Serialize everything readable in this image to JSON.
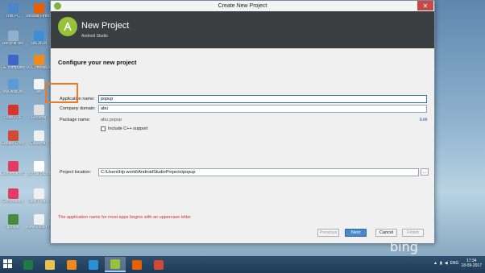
{
  "window": {
    "title": "Create New Project",
    "close_glyph": "✕",
    "minimize_glyph": "–",
    "maximize_glyph": "□"
  },
  "banner": {
    "title": "New Project",
    "subtitle": "Android Studio"
  },
  "form": {
    "heading": "Configure your new project",
    "app_name_label": "Application name:",
    "app_name_value": "popup",
    "company_domain_label": "Company domain:",
    "company_domain_value": "abu",
    "package_name_label": "Package name:",
    "package_name_value": "abu.popup",
    "edit_link": "Edit",
    "cpp_support_label": "Include C++ support",
    "project_location_label": "Project location:",
    "project_location_value": "C:\\Users\\Hp world\\AndroidStudioProjects\\popup",
    "browse_label": "...",
    "warning": "The application name for most apps begins with an uppercase letter"
  },
  "buttons": {
    "previous": "Previous",
    "next": "Next",
    "cancel": "Cancel",
    "finish": "Finish"
  },
  "desktop_icons": [
    {
      "label": "This PC",
      "color": "#4a86c8"
    },
    {
      "label": "Mozilla Firefox",
      "color": "#e66000"
    },
    {
      "label": "Recycle Bin",
      "color": "#8fb0cf"
    },
    {
      "label": "SNCBOB",
      "color": "#3d8fd8"
    },
    {
      "label": "DE computer",
      "color": "#3d66c8"
    },
    {
      "label": "VLC media player",
      "color": "#f08a1c"
    },
    {
      "label": "MyDeskUtil",
      "color": "#5a9bd5"
    },
    {
      "label": "ab",
      "color": "#f5f5f5"
    },
    {
      "label": "Foxit PDF",
      "color": "#d7342b"
    },
    {
      "label": "Resume",
      "color": "#e0e0e0"
    },
    {
      "label": "Google Chrome",
      "color": "#d04a34"
    },
    {
      "label": "Classmay",
      "color": "#f0f0f0"
    },
    {
      "label": "Genymotion Shell",
      "color": "#e23c64"
    },
    {
      "label": "journal paper",
      "color": "#ffffff"
    },
    {
      "label": "Genymotion",
      "color": "#e23c64"
    },
    {
      "label": "New Folder",
      "color": "#f0f0f0"
    },
    {
      "label": "google",
      "color": "#4a8a3c"
    },
    {
      "label": "New Folder (2)",
      "color": "#f0f0f0"
    }
  ],
  "watermark": "bing",
  "taskbar": {
    "apps": [
      {
        "name": "excel",
        "color": "#1d7a44"
      },
      {
        "name": "file-explorer",
        "color": "#e8c24a"
      },
      {
        "name": "vlc",
        "color": "#f08a1c"
      },
      {
        "name": "internet-explorer",
        "color": "#2b8fd8"
      },
      {
        "name": "android-studio",
        "color": "#97c13b"
      },
      {
        "name": "firefox",
        "color": "#e66000"
      },
      {
        "name": "chrome",
        "color": "#d04a34"
      }
    ],
    "language": "ENG",
    "time": "17:34",
    "date": "18-09-2017"
  }
}
